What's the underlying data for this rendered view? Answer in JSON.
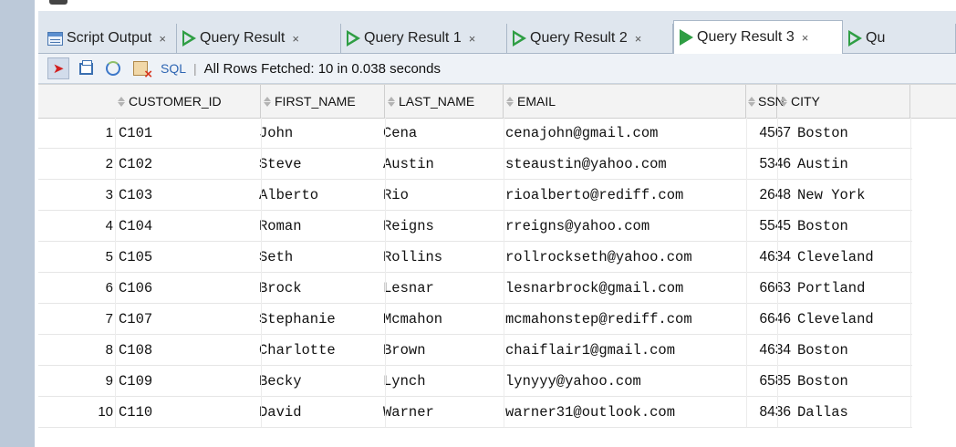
{
  "tabs": [
    {
      "label": "Script Output",
      "icon": "script-output-icon",
      "close": "×",
      "active": false
    },
    {
      "label": "Query Result",
      "icon": "run-query-icon",
      "close": "×",
      "active": false
    },
    {
      "label": "Query Result 1",
      "icon": "run-query-icon",
      "close": "×",
      "active": false
    },
    {
      "label": "Query Result 2",
      "icon": "run-query-icon",
      "close": "×",
      "active": false
    },
    {
      "label": "Query Result 3",
      "icon": "run-query-icon",
      "close": "×",
      "active": true
    },
    {
      "label": "Qu",
      "icon": "run-query-icon",
      "close": "",
      "active": false
    }
  ],
  "toolbar": {
    "sql_label": "SQL",
    "separator": "|",
    "status": "All Rows Fetched: 10 in 0.038 seconds"
  },
  "grid": {
    "columns": [
      "CUSTOMER_ID",
      "FIRST_NAME",
      "LAST_NAME",
      "EMAIL",
      "SSN",
      "CITY"
    ],
    "rows": [
      {
        "n": "1",
        "cells": [
          "C101",
          "John",
          "Cena",
          "cenajohn@gmail.com",
          "4567",
          "Boston"
        ]
      },
      {
        "n": "2",
        "cells": [
          "C102",
          "Steve",
          "Austin",
          "steaustin@yahoo.com",
          "5346",
          "Austin"
        ]
      },
      {
        "n": "3",
        "cells": [
          "C103",
          "Alberto",
          "Rio",
          "rioalberto@rediff.com",
          "2648",
          "New York"
        ]
      },
      {
        "n": "4",
        "cells": [
          "C104",
          "Roman",
          "Reigns",
          "rreigns@yahoo.com",
          "5545",
          "Boston"
        ]
      },
      {
        "n": "5",
        "cells": [
          "C105",
          "Seth",
          "Rollins",
          "rollrockseth@yahoo.com",
          "4634",
          "Cleveland"
        ]
      },
      {
        "n": "6",
        "cells": [
          "C106",
          "Brock",
          "Lesnar",
          "lesnarbrock@gmail.com",
          "6663",
          "Portland"
        ]
      },
      {
        "n": "7",
        "cells": [
          "C107",
          "Stephanie",
          "Mcmahon",
          "mcmahonstep@rediff.com",
          "6646",
          "Cleveland"
        ]
      },
      {
        "n": "8",
        "cells": [
          "C108",
          "Charlotte",
          "Brown",
          "chaiflair1@gmail.com",
          "4634",
          "Boston"
        ]
      },
      {
        "n": "9",
        "cells": [
          "C109",
          "Becky",
          "Lynch",
          "lynyyy@yahoo.com",
          "6585",
          "Boston"
        ]
      },
      {
        "n": "10",
        "cells": [
          "C110",
          "David",
          "Warner",
          "warner31@outlook.com",
          "8436",
          "Dallas"
        ]
      }
    ]
  }
}
